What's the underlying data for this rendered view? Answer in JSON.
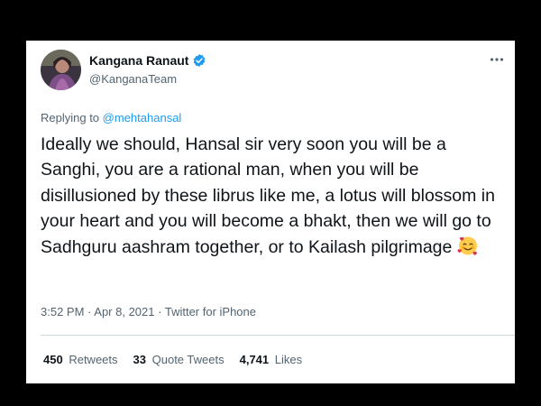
{
  "tweet": {
    "display_name": "Kangana Ranaut",
    "handle": "@KanganaTeam",
    "more_icon": "more-icon",
    "replying_prefix": "Replying to",
    "replying_to": "@mehtahansal",
    "text": "Ideally we should, Hansal sir very soon you will be a Sanghi, you are a rational man, when you will be disillusioned by these librus like me, a lotus will blossom in your heart and you will become a bhakt, then we will go to Sadhguru aashram together, or to Kailash pilgrimage",
    "emoji": "smiling-face-with-hearts",
    "time": "3:52 PM",
    "date": "Apr 8, 2021",
    "client": "Twitter for iPhone",
    "stats": {
      "retweets_count": "450",
      "retweets_label": "Retweets",
      "quotes_count": "33",
      "quotes_label": "Quote Tweets",
      "likes_count": "4,741",
      "likes_label": "Likes"
    },
    "colors": {
      "link": "#1d9bf0",
      "verified": "#1d9bf0",
      "text": "#0f1419",
      "secondary": "#536471"
    }
  }
}
